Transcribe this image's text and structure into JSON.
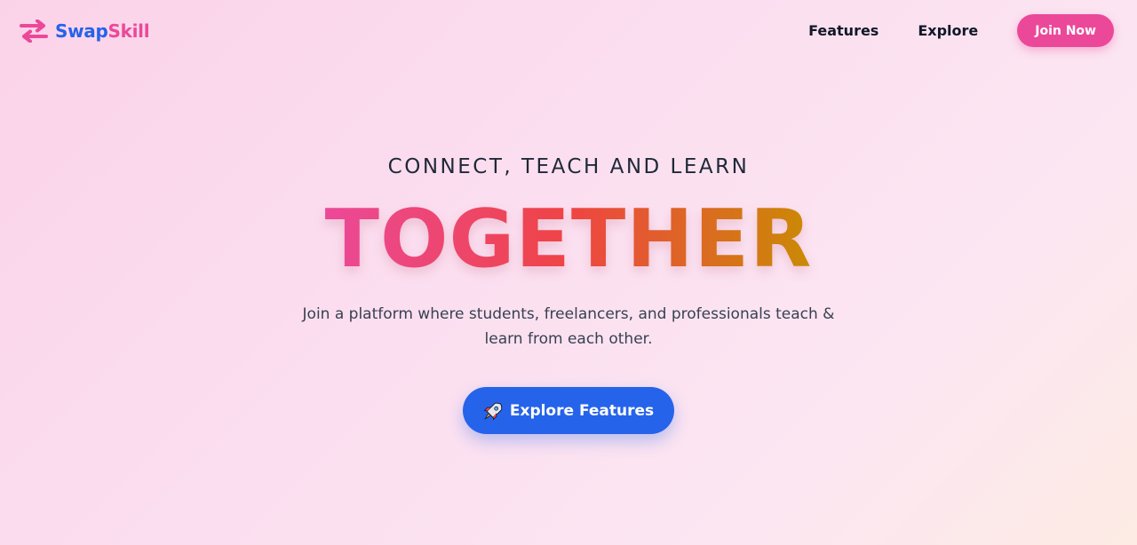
{
  "brand": {
    "name_part1": "Swap",
    "name_part2": "Skill",
    "icon": "swap-arrows-icon",
    "colors": {
      "primary": "#2563eb",
      "accent": "#ec4899"
    }
  },
  "nav": {
    "links": [
      {
        "label": "Features"
      },
      {
        "label": "Explore"
      }
    ],
    "cta_label": "Join Now"
  },
  "hero": {
    "subtitle": "CONNECT, TEACH AND LEARN",
    "headline": "TOGETHER",
    "headline_gradient": [
      "#ec4899",
      "#ef4444",
      "#ca8a04"
    ],
    "description": "Join a platform where students, freelancers, and professionals teach & learn from each other.",
    "cta": {
      "icon": "rocket-icon",
      "label": "Explore Features"
    }
  }
}
